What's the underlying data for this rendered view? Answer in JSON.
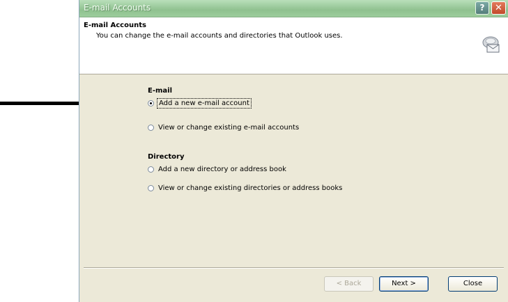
{
  "window": {
    "title": "E-mail Accounts",
    "help_glyph": "?",
    "close_glyph": "✕"
  },
  "header": {
    "title": "E-mail Accounts",
    "description": "You can change the e-mail accounts and directories that Outlook uses.",
    "icon": "email-accounts-icon"
  },
  "email_group": {
    "label": "E-mail",
    "options": [
      {
        "label": "Add a new e-mail account",
        "selected": true,
        "focused": true
      },
      {
        "label": "View or change existing e-mail accounts",
        "selected": false
      }
    ]
  },
  "directory_group": {
    "label": "Directory",
    "options": [
      {
        "label": "Add a new directory or address book",
        "selected": false
      },
      {
        "label": "View or change existing directories or address books",
        "selected": false
      }
    ]
  },
  "buttons": {
    "back": "< Back",
    "next": "Next >",
    "close": "Close"
  },
  "pointer": {
    "icon": "pointer-arrow"
  }
}
